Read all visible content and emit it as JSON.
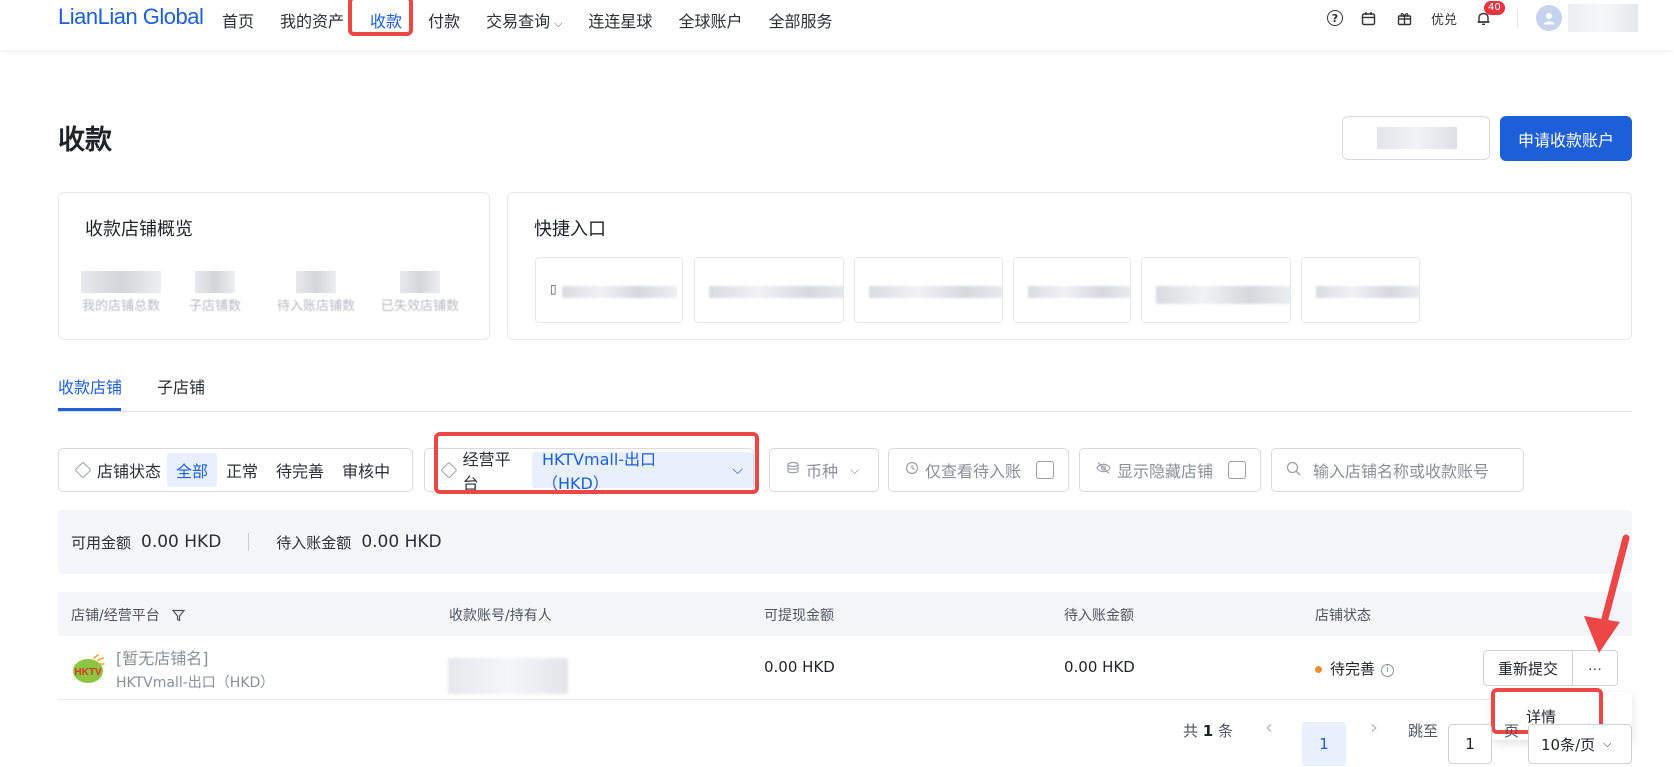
{
  "header": {
    "logo": "LianLian Global",
    "nav": [
      "首页",
      "我的资产",
      "收款",
      "付款",
      "交易查询",
      "连连星球",
      "全球账户",
      "全部服务"
    ],
    "nav_dropdown_chevron": "⌵",
    "help_glyph": "?",
    "exchange_label": "优兑",
    "notification_count": "40"
  },
  "page": {
    "title": "收款",
    "apply_button": "申请收款账户"
  },
  "overview": {
    "title": "收款店铺概览",
    "stats": [
      "我的店铺总数",
      "子店铺数",
      "待入账店铺数",
      "已失效店铺数"
    ]
  },
  "quick": {
    "title": "快捷入口",
    "first_icon": "▯"
  },
  "tabs": [
    "收款店铺",
    "子店铺"
  ],
  "filters": {
    "status_label": "店铺状态",
    "status_options": [
      "全部",
      "正常",
      "待完善",
      "审核中"
    ],
    "platform_label": "经营平台",
    "platform_value": "HKTVmall-出口（HKD）",
    "currency_label": "币种",
    "pending_only": "仅查看待入账",
    "show_hidden": "显示隐藏店铺",
    "search_placeholder": "输入店铺名称或收款账号"
  },
  "summary": {
    "available_label": "可用金额",
    "available_value": "0.00 HKD",
    "pending_label": "待入账金额",
    "pending_value": "0.00 HKD"
  },
  "table": {
    "columns": [
      "店铺/经营平台",
      "收款账号/持有人",
      "可提现金额",
      "待入账金额",
      "店铺状态"
    ],
    "rows": [
      {
        "logo": "HKTV",
        "shop_name": "[暂无店铺名]",
        "platform": "HKTVmall-出口（HKD）",
        "withdrawable": "0.00 HKD",
        "pending": "0.00 HKD",
        "status": "待完善",
        "resubmit": "重新提交",
        "more": "···"
      }
    ]
  },
  "dropdown": {
    "detail": "详情"
  },
  "pagination": {
    "total_prefix": "共",
    "total": "1",
    "total_suffix": "条",
    "prev": "‹",
    "current": "1",
    "next": "›",
    "goto_label": "跳至",
    "goto_value": "1",
    "goto_suffix": "页",
    "page_size": "10条/页"
  },
  "colors": {
    "brand": "#1c5fd9",
    "highlight": "#ec4646",
    "status_pending": "#f08c2c"
  }
}
